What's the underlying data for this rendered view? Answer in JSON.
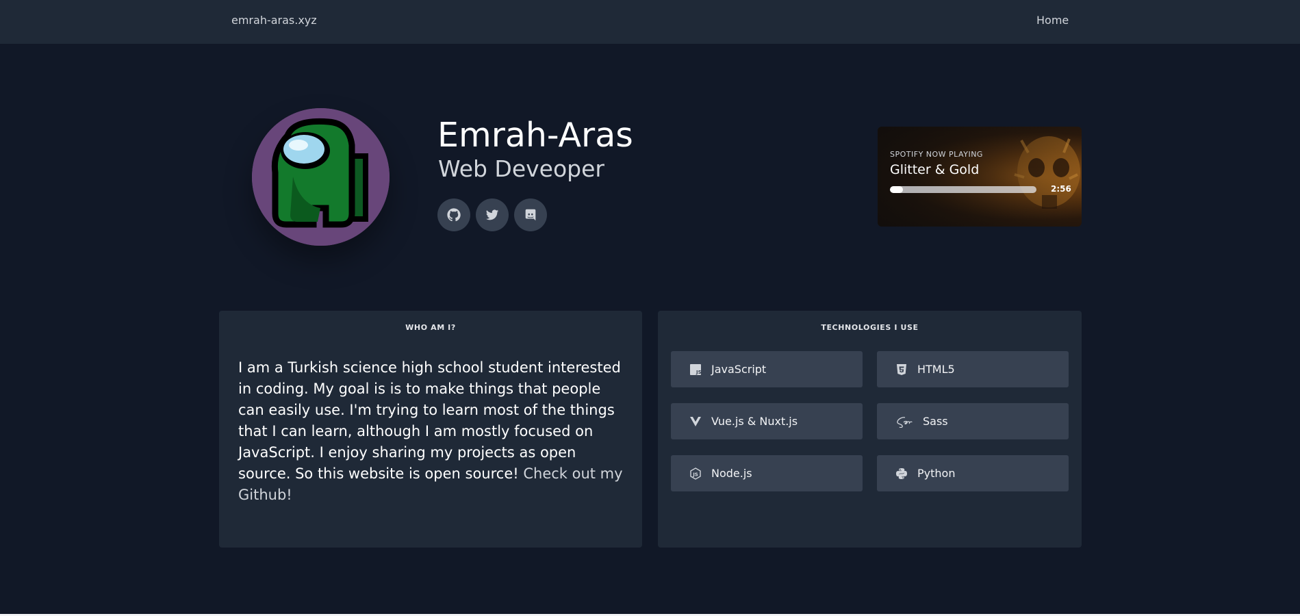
{
  "header": {
    "brand": "emrah-aras.xyz",
    "nav_home": "Home"
  },
  "profile": {
    "name": "Emrah-Aras",
    "role": "Web Deveoper",
    "socials": [
      {
        "icon": "github-icon"
      },
      {
        "icon": "twitter-icon"
      },
      {
        "icon": "discord-icon"
      }
    ]
  },
  "spotify": {
    "label": "SPOTIFY NOW PLAYING",
    "song": "Glitter & Gold",
    "duration": "2:56",
    "progress": 0.09
  },
  "about": {
    "title": "WHO AM I?",
    "text": "I am a Turkish science high school student interested in coding. My goal is is to make things that people can easily use. I'm trying to learn most of the things that I can learn, although I am mostly focused on JavaScript. I enjoy sharing my projects as open source. So this website is open source!",
    "link": "Check out my Github!"
  },
  "technologies": {
    "title": "TECHNOLOGIES I USE",
    "items": [
      {
        "label": "JavaScript",
        "icon": "javascript-icon"
      },
      {
        "label": "HTML5",
        "icon": "html5-icon"
      },
      {
        "label": "Vue.js & Nuxt.js",
        "icon": "vue-icon"
      },
      {
        "label": "Sass",
        "icon": "sass-icon"
      },
      {
        "label": "Node.js",
        "icon": "nodejs-icon"
      },
      {
        "label": "Python",
        "icon": "python-icon"
      }
    ]
  },
  "colors": {
    "background": "#111827",
    "surface": "#1f2937",
    "chip": "#374151",
    "avatar_bg": "#68467a"
  }
}
